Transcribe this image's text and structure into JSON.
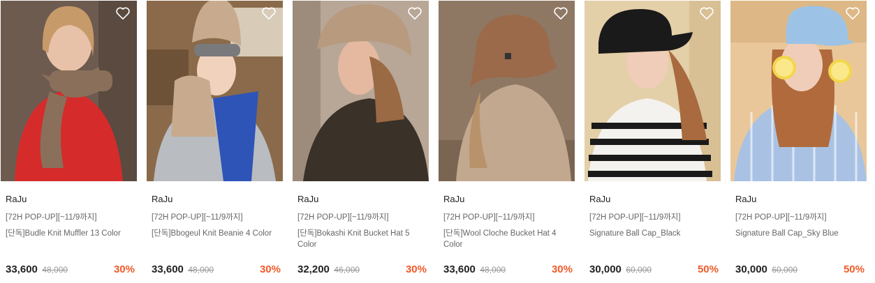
{
  "products": [
    {
      "brand": "RaJu",
      "tag": "[72H POP-UP][~11/9까지]",
      "name": "[단독]Budle Knit Muffler 13 Color",
      "price": "33,600",
      "original_price": "48,000",
      "discount": "30%",
      "colors": {
        "bg": "#6e5b50",
        "bg2": "#5a4a40",
        "item": "#8a6f5a",
        "top": "#d52b2b",
        "skin": "#e8c2a8",
        "hair": "#c79a6a"
      }
    },
    {
      "brand": "RaJu",
      "tag": "[72H POP-UP][~11/9까지]",
      "name": "[단독]Bbogeul Knit Beanie 4 Color",
      "price": "33,600",
      "original_price": "48,000",
      "discount": "30%",
      "colors": {
        "bg": "#8a6a4a",
        "bg2": "#6e5238",
        "item": "#c8ab8e",
        "top": "#2e54b8",
        "skin": "#f0d2bd",
        "hair": "#d2b48c"
      }
    },
    {
      "brand": "RaJu",
      "tag": "[72H POP-UP][~11/9까지]",
      "name": "[단독]Bokashi Knit Bucket Hat 5 Color",
      "price": "32,200",
      "original_price": "46,000",
      "discount": "30%",
      "colors": {
        "bg": "#b8a797",
        "bg2": "#9d8c7c",
        "item": "#b89a7e",
        "top": "#3a3128",
        "skin": "#e4b9a0",
        "hair": "#9a6a44"
      }
    },
    {
      "brand": "RaJu",
      "tag": "[72H POP-UP][~11/9까지]",
      "name": "[단독]Wool Cloche Bucket Hat 4 Color",
      "price": "33,600",
      "original_price": "48,000",
      "discount": "30%",
      "colors": {
        "bg": "#8e7864",
        "bg2": "#7a6452",
        "item": "#9a6a4a",
        "top": "#c2a88e",
        "skin": "#e4b9a0",
        "hair": "#b8926a"
      }
    },
    {
      "brand": "RaJu",
      "tag": "[72H POP-UP][~11/9까지]",
      "name": "Signature Ball Cap_Black",
      "price": "30,000",
      "original_price": "60,000",
      "discount": "50%",
      "colors": {
        "bg": "#e3cfa8",
        "bg2": "#d8c094",
        "item": "#1a1a1a",
        "top": "#f4f2ee",
        "skin": "#f0cdb8",
        "hair": "#a86a3e"
      }
    },
    {
      "brand": "RaJu",
      "tag": "[72H POP-UP][~11/9까지]",
      "name": "Signature Ball Cap_Sky Blue",
      "price": "30,000",
      "original_price": "60,000",
      "discount": "50%",
      "colors": {
        "bg": "#e9c79a",
        "bg2": "#ddb886",
        "item": "#9cc3e6",
        "top": "#a9c2e4",
        "skin": "#f0cdb8",
        "hair": "#b06a3c"
      }
    }
  ],
  "icons": {
    "wishlist": "heart-outline-icon"
  }
}
